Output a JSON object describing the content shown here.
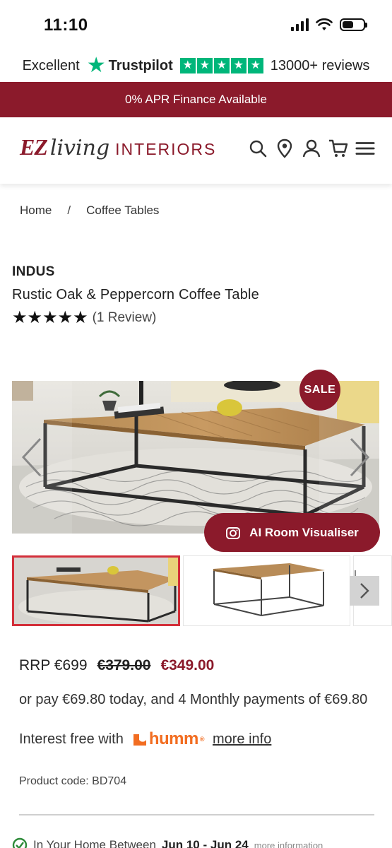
{
  "status_bar": {
    "time": "11:10"
  },
  "trustpilot": {
    "rating_text": "Excellent",
    "brand": "Trustpilot",
    "reviews": "13000+ reviews",
    "color": "#00b67a"
  },
  "promo_banner": {
    "text": "0% APR Finance Available",
    "color": "#8b1a2b"
  },
  "header": {
    "logo": {
      "ez": "EZ",
      "living": "living",
      "interiors": "INTERIORS"
    },
    "icons": [
      "search-icon",
      "location-pin-icon",
      "account-icon",
      "cart-icon",
      "menu-icon"
    ]
  },
  "breadcrumb": {
    "home": "Home",
    "separator": "/",
    "current": "Coffee Tables"
  },
  "product": {
    "brand": "INDUS",
    "title": "Rustic Oak & Peppercorn Coffee Table",
    "stars": "★★★★★",
    "rating": 5,
    "review_count": "(1 Review)"
  },
  "gallery": {
    "sale_badge": "SALE",
    "ai_button": "AI Room Visualiser",
    "selected_thumbnail": 1
  },
  "pricing": {
    "rrp": "RRP €699",
    "old_price": "€379.00",
    "sale_price": "€349.00",
    "installments": "or pay €69.80 today, and 4 Monthly payments of €69.80",
    "interest_free": "Interest free with",
    "humm": "humm",
    "more_info": "more info"
  },
  "product_code": "Product code: BD704",
  "delivery": {
    "label": "In Your Home Between",
    "range": "Jun 10 - Jun 24",
    "more": "more information"
  },
  "colors": {
    "accent": "#8b1a2b",
    "thumb_border": "#d32f3a",
    "humm": "#f26d21"
  }
}
